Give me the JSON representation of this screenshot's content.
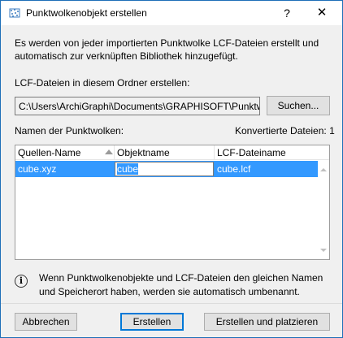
{
  "window": {
    "title": "Punktwolkenobjekt erstellen",
    "help_glyph": "?",
    "close_glyph": "✕"
  },
  "intro": "Es werden von jeder importierten Punktwolke LCF-Dateien erstellt und automatisch zur verknüpften Bibliothek hinzugefügt.",
  "folder": {
    "label": "LCF-Dateien in diesem Ordner erstellen:",
    "path": "C:\\Users\\ArchiGraphi\\Documents\\GRAPHISOFT\\Punktwolk",
    "browse_label": "Suchen..."
  },
  "list": {
    "label": "Namen der Punktwolken:",
    "converted": "Konvertierte Dateien: 1",
    "columns": [
      "Quellen-Name",
      "Objektname",
      "LCF-Dateiname"
    ],
    "rows": [
      {
        "source": "cube.xyz",
        "object": "cube",
        "lcf": "cube.lcf"
      }
    ]
  },
  "info": "Wenn Punktwolkenobjekte und LCF-Dateien den gleichen Namen und Speicherort haben, werden sie automatisch umbenannt.",
  "buttons": {
    "cancel": "Abbrechen",
    "create": "Erstellen",
    "create_place": "Erstellen und platzieren"
  },
  "colors": {
    "selection": "#3399ff",
    "focus_border": "#0078d7",
    "window_border": "#1e6fb8"
  },
  "icons": [
    "point-cloud-app-icon",
    "sort-ascending-icon",
    "scroll-up-icon",
    "scroll-down-icon",
    "info-icon"
  ]
}
